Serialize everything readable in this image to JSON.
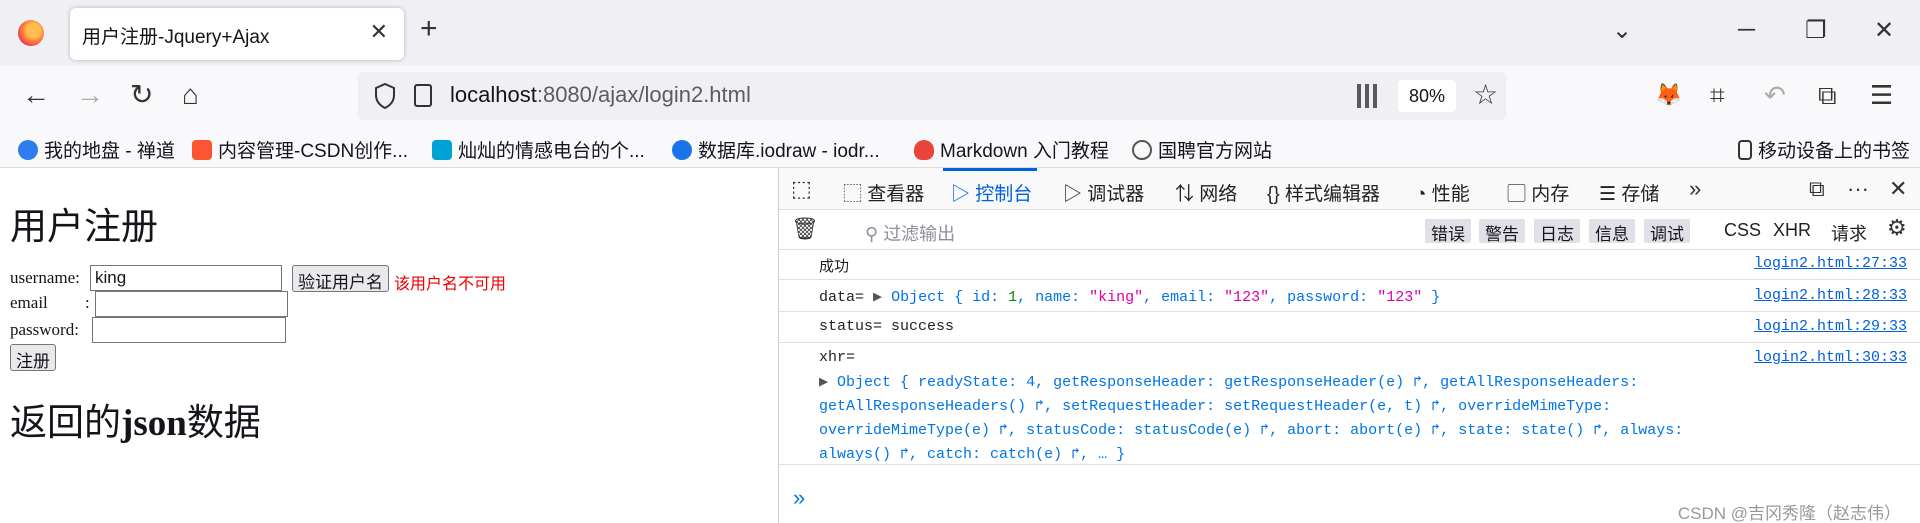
{
  "browser": {
    "tab_title": "用户注册-Jquery+Ajax",
    "url_host": "localhost",
    "url_rest": ":8080/ajax/login2.html",
    "zoom": "80%"
  },
  "bookmarks": [
    {
      "label": "我的地盘 - 禅道",
      "color": "#2d7cf0"
    },
    {
      "label": "内容管理-CSDN创作...",
      "color": "#fc5531"
    },
    {
      "label": "灿灿的情感电台的个...",
      "color": "#00a1d6"
    },
    {
      "label": "数据库.iodraw - iodr...",
      "color": "#1a73e8"
    },
    {
      "label": "Markdown 入门教程",
      "color": "#e8443a"
    },
    {
      "label": "国聘官方网站",
      "color": "#555555"
    },
    {
      "label": "移动设备上的书签",
      "color": "#333333"
    }
  ],
  "page": {
    "heading": "用户注册",
    "username_label": "username:",
    "username_value": "king",
    "check_button": "验证用户名",
    "error_msg": "该用户名不可用",
    "email_label": "email",
    "email_colon": ":",
    "password_label": "password:",
    "register_button": "注册",
    "json_heading_pre": "返回的",
    "json_heading_bold": "json",
    "json_heading_post": "数据"
  },
  "devtools": {
    "tabs": [
      "查看器",
      "控制台",
      "调试器",
      "网络",
      "样式编辑器",
      "性能",
      "内存",
      "存储"
    ],
    "active_tab": "控制台",
    "filter_placeholder": "过滤输出",
    "levels": [
      "错误",
      "警告",
      "日志",
      "信息",
      "调试"
    ],
    "extra_filters": [
      "CSS",
      "XHR",
      "请求"
    ],
    "messages": [
      {
        "text": "成功",
        "location": "login2.html:27:33"
      },
      {
        "prefix": "data= ",
        "location": "login2.html:28:33"
      },
      {
        "text": "status= success",
        "location": "login2.html:29:33"
      },
      {
        "prefix": "xhr=",
        "location": "login2.html:30:33"
      }
    ],
    "data_obj": {
      "head": "Object { id: ",
      "id": "1",
      "k2": ", name: ",
      "name": "\"king\"",
      "k3": ", email: ",
      "email": "\"123\"",
      "k4": ", password: ",
      "password": "\"123\"",
      "tail": " }"
    },
    "xhr_lines": [
      "Object { readyState: 4, getResponseHeader: getResponseHeader(e) ↱, getAllResponseHeaders:",
      "getAllResponseHeaders() ↱, setRequestHeader: setRequestHeader(e, t) ↱, overrideMimeType:",
      "overrideMimeType(e) ↱, statusCode: statusCode(e) ↱, abort: abort(e) ↱, state: state() ↱, always:",
      "always() ↱, catch: catch(e) ↱, … }"
    ],
    "watermark": "CSDN @吉冈秀隆（赵志伟）"
  }
}
